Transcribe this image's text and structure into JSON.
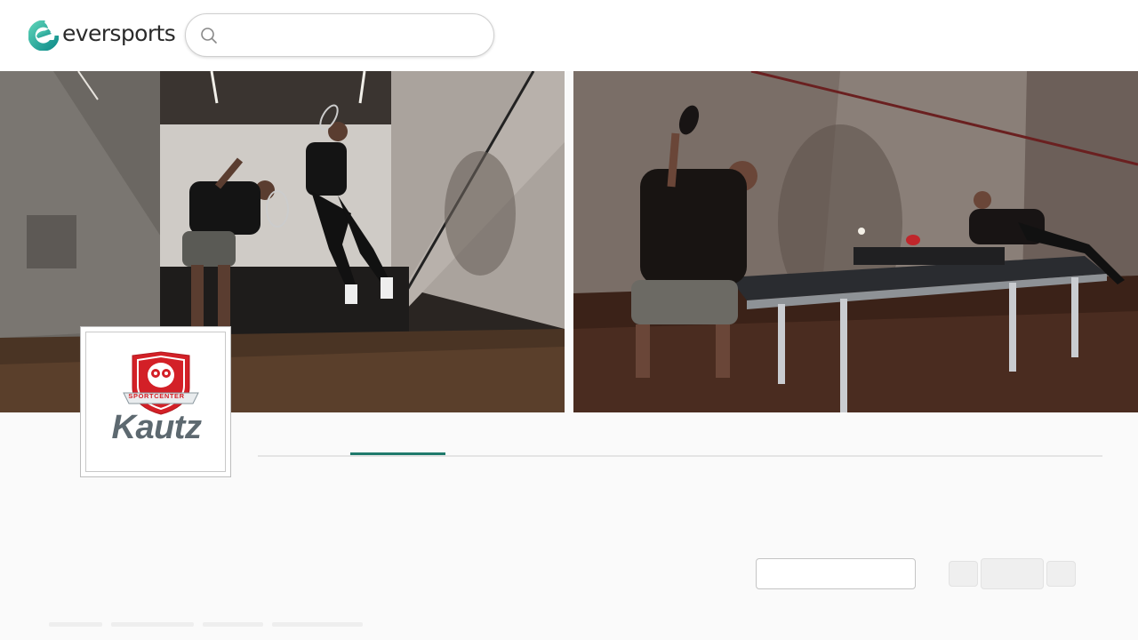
{
  "app": {
    "brand": "eversports"
  },
  "search": {
    "value": "",
    "placeholder": ""
  },
  "studio": {
    "logo_top_text": "SPORTCENTER",
    "logo_name": "Kautz"
  },
  "photos": [
    {
      "alt": "Two players jumping on a squash court"
    },
    {
      "alt": "Two players playing table tennis on a DONIC table"
    }
  ],
  "colors": {
    "brand_teal": "#1f7a6c",
    "logo_red": "#d32027",
    "logo_gray": "#5d6970"
  },
  "icons": {
    "search": "search-icon"
  }
}
